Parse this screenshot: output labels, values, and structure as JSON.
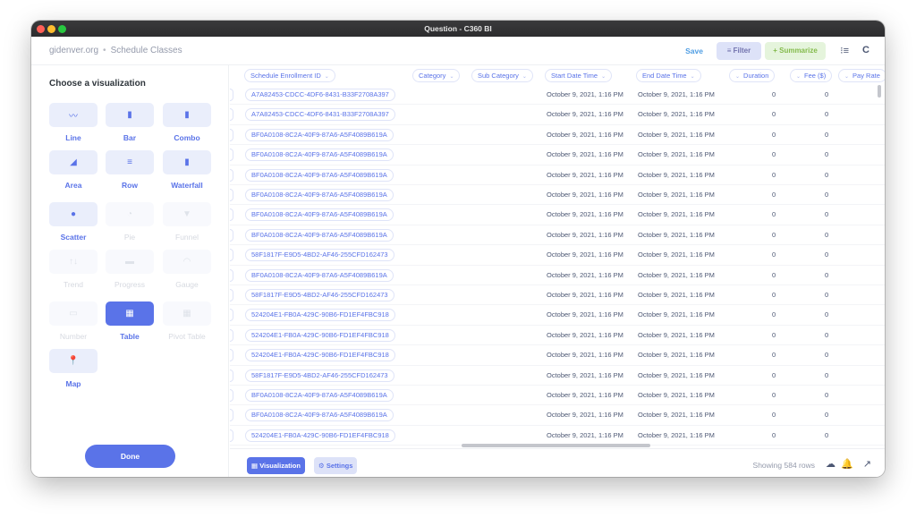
{
  "window": {
    "title": "Question - C360 BI"
  },
  "header": {
    "breadcrumb": [
      "gidenver.org",
      "Schedule Classes"
    ],
    "breadcrumb_sep": "•",
    "save_label": "Save",
    "filter_label": "Filter",
    "filter_icon": "≡",
    "summarize_label": "Summarize",
    "summarize_icon": "+",
    "editor_icon": "⁝≡",
    "refresh_icon": "C"
  },
  "sidebar": {
    "title": "Choose a visualization",
    "items": [
      {
        "label": "Line",
        "icon": "〰",
        "state": "enabled"
      },
      {
        "label": "Bar",
        "icon": "▮",
        "state": "enabled"
      },
      {
        "label": "Combo",
        "icon": "▮",
        "state": "enabled"
      },
      {
        "label": "Area",
        "icon": "◢",
        "state": "enabled"
      },
      {
        "label": "Row",
        "icon": "≡",
        "state": "enabled"
      },
      {
        "label": "Waterfall",
        "icon": "▮",
        "state": "enabled"
      },
      {
        "label": "Scatter",
        "icon": "●",
        "state": "enabled"
      },
      {
        "label": "Pie",
        "icon": "◔",
        "state": "disabled"
      },
      {
        "label": "Funnel",
        "icon": "▼",
        "state": "disabled"
      },
      {
        "label": "Trend",
        "icon": "↑↓",
        "state": "disabled"
      },
      {
        "label": "Progress",
        "icon": "▬",
        "state": "disabled"
      },
      {
        "label": "Gauge",
        "icon": "◠",
        "state": "disabled"
      },
      {
        "label": "Number",
        "icon": "▭",
        "state": "disabled"
      },
      {
        "label": "Table",
        "icon": "▦",
        "state": "active"
      },
      {
        "label": "Pivot Table",
        "icon": "▦",
        "state": "disabled"
      },
      {
        "label": "Map",
        "icon": "📍",
        "state": "enabled"
      }
    ],
    "done_label": "Done"
  },
  "table": {
    "columns": [
      "Schedule Enrollment ID",
      "Category",
      "Sub Category",
      "Start Date Time",
      "End Date Time",
      "Duration",
      "Fee ($)",
      "Pay Rate"
    ],
    "rows": [
      [
        "A7A82453-CDCC-4DF6-8431-B33F2708A397",
        "",
        "",
        "October 9, 2021, 1:16 PM",
        "October 9, 2021, 1:16 PM",
        "0",
        "0"
      ],
      [
        "A7A82453-CDCC-4DF6-8431-B33F2708A397",
        "",
        "",
        "October 9, 2021, 1:16 PM",
        "October 9, 2021, 1:16 PM",
        "0",
        "0"
      ],
      [
        "BF0A0108-8C2A-40F9-87A6-A5F4089B619A",
        "",
        "",
        "October 9, 2021, 1:16 PM",
        "October 9, 2021, 1:16 PM",
        "0",
        "0"
      ],
      [
        "BF0A0108-8C2A-40F9-87A6-A5F4089B619A",
        "",
        "",
        "October 9, 2021, 1:16 PM",
        "October 9, 2021, 1:16 PM",
        "0",
        "0"
      ],
      [
        "BF0A0108-8C2A-40F9-87A6-A5F4089B619A",
        "",
        "",
        "October 9, 2021, 1:16 PM",
        "October 9, 2021, 1:16 PM",
        "0",
        "0"
      ],
      [
        "BF0A0108-8C2A-40F9-87A6-A5F4089B619A",
        "",
        "",
        "October 9, 2021, 1:16 PM",
        "October 9, 2021, 1:16 PM",
        "0",
        "0"
      ],
      [
        "BF0A0108-8C2A-40F9-87A6-A5F4089B619A",
        "",
        "",
        "October 9, 2021, 1:16 PM",
        "October 9, 2021, 1:16 PM",
        "0",
        "0"
      ],
      [
        "BF0A0108-8C2A-40F9-87A6-A5F4089B619A",
        "",
        "",
        "October 9, 2021, 1:16 PM",
        "October 9, 2021, 1:16 PM",
        "0",
        "0"
      ],
      [
        "58F1817F-E9D5-4BD2-AF46-255CFD162473",
        "",
        "",
        "October 9, 2021, 1:16 PM",
        "October 9, 2021, 1:16 PM",
        "0",
        "0"
      ],
      [
        "BF0A0108-8C2A-40F9-87A6-A5F4089B619A",
        "",
        "",
        "October 9, 2021, 1:16 PM",
        "October 9, 2021, 1:16 PM",
        "0",
        "0"
      ],
      [
        "58F1817F-E9D5-4BD2-AF46-255CFD162473",
        "",
        "",
        "October 9, 2021, 1:16 PM",
        "October 9, 2021, 1:16 PM",
        "0",
        "0"
      ],
      [
        "524204E1-FB0A-429C-90B6-FD1EF4FBC918",
        "",
        "",
        "October 9, 2021, 1:16 PM",
        "October 9, 2021, 1:16 PM",
        "0",
        "0"
      ],
      [
        "524204E1-FB0A-429C-90B6-FD1EF4FBC918",
        "",
        "",
        "October 9, 2021, 1:16 PM",
        "October 9, 2021, 1:16 PM",
        "0",
        "0"
      ],
      [
        "524204E1-FB0A-429C-90B6-FD1EF4FBC918",
        "",
        "",
        "October 9, 2021, 1:16 PM",
        "October 9, 2021, 1:16 PM",
        "0",
        "0"
      ],
      [
        "58F1817F-E9D5-4BD2-AF46-255CFD162473",
        "",
        "",
        "October 9, 2021, 1:16 PM",
        "October 9, 2021, 1:16 PM",
        "0",
        "0"
      ],
      [
        "BF0A0108-8C2A-40F9-87A6-A5F4089B619A",
        "",
        "",
        "October 9, 2021, 1:16 PM",
        "October 9, 2021, 1:16 PM",
        "0",
        "0"
      ],
      [
        "BF0A0108-8C2A-40F9-87A6-A5F4089B619A",
        "",
        "",
        "October 9, 2021, 1:16 PM",
        "October 9, 2021, 1:16 PM",
        "0",
        "0"
      ],
      [
        "524204E1-FB0A-429C-90B6-FD1EF4FBC918",
        "",
        "",
        "October 9, 2021, 1:16 PM",
        "October 9, 2021, 1:16 PM",
        "0",
        "0"
      ]
    ]
  },
  "footer": {
    "visualization_label": "Visualization",
    "visualization_icon": "▦",
    "settings_label": "Settings",
    "settings_icon": "⚙",
    "rows_text": "Showing 584 rows",
    "download_icon": "☁",
    "alert_icon": "🔔",
    "expand_icon": "↗"
  },
  "colors": {
    "brand": "#5a73e8",
    "filter_bg": "#dde2f8",
    "summarize_bg": "#e5f4dc",
    "summarize_text": "#84bb4c"
  }
}
